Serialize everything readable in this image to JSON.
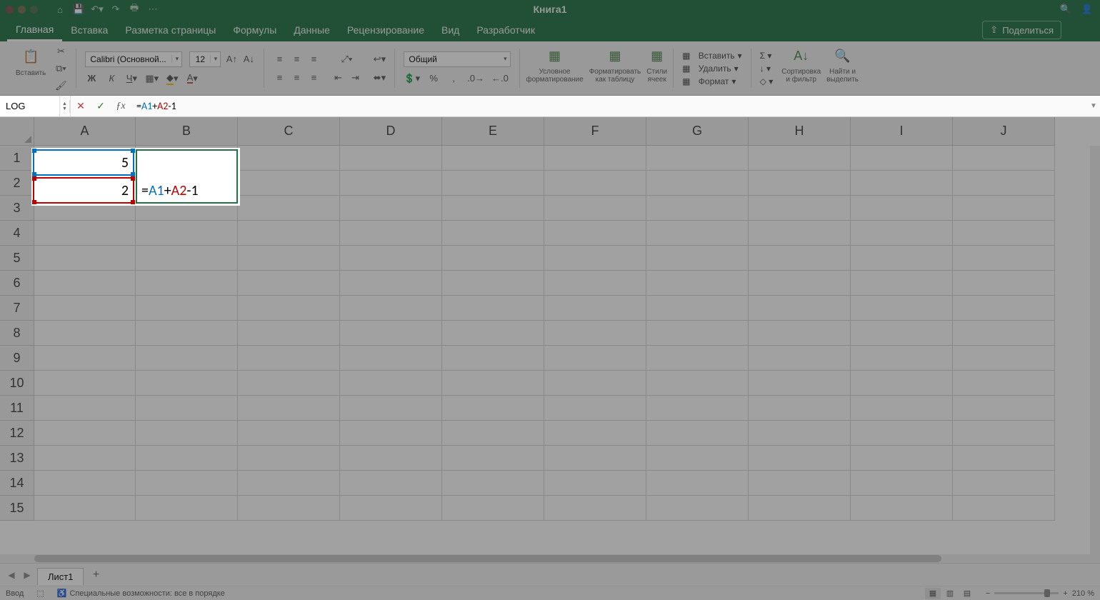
{
  "title": "Книга1",
  "tabs": [
    {
      "label": "Главная",
      "active": true
    },
    {
      "label": "Вставка"
    },
    {
      "label": "Разметка страницы"
    },
    {
      "label": "Формулы"
    },
    {
      "label": "Данные"
    },
    {
      "label": "Рецензирование"
    },
    {
      "label": "Вид"
    },
    {
      "label": "Разработчик"
    }
  ],
  "share": "Поделиться",
  "ribbon": {
    "paste_label": "Вставить",
    "font_name": "Calibri (Основной...",
    "font_size": "12",
    "number_format": "Общий",
    "cond_format_line1": "Условное",
    "cond_format_line2": "форматирование",
    "format_table_line1": "Форматировать",
    "format_table_line2": "как таблицу",
    "cell_styles_line1": "Стили",
    "cell_styles_line2": "ячеек",
    "insert_label": "Вставить",
    "delete_label": "Удалить",
    "format_label": "Формат",
    "sort_filter_line1": "Сортировка",
    "sort_filter_line2": "и фильтр",
    "find_select_line1": "Найти и",
    "find_select_line2": "выделить"
  },
  "formula_bar": {
    "name_box": "LOG",
    "formula_prefix": "=",
    "formula_ref1": "A1",
    "formula_op1": "+",
    "formula_ref2": "A2",
    "formula_suffix": "-1"
  },
  "columns": [
    "A",
    "B",
    "C",
    "D",
    "E",
    "F",
    "G",
    "H",
    "I",
    "J"
  ],
  "rows": [
    "1",
    "2",
    "3",
    "4",
    "5",
    "6",
    "7",
    "8",
    "9",
    "10",
    "11",
    "12",
    "13",
    "14",
    "15"
  ],
  "cells": {
    "A1": "5",
    "A2": "2",
    "B2_display_prefix": "=",
    "B2_display_ref1": "A1",
    "B2_display_op1": "+",
    "B2_display_ref2": "A2",
    "B2_display_suffix": "-1"
  },
  "sheet_tab": "Лист1",
  "status_mode": "Ввод",
  "accessibility": "Специальные возможности: все в порядке",
  "zoom": "210 %"
}
